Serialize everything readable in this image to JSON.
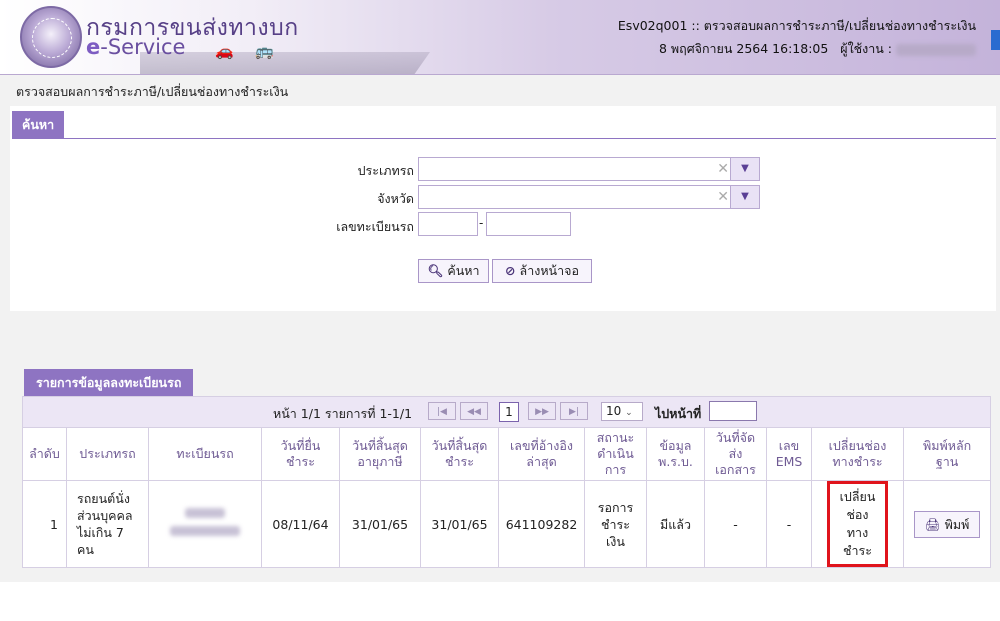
{
  "header": {
    "brand_title": "กรมการขนส่งทางบก",
    "brand_sub_prefix": "e",
    "brand_sub": "-Service",
    "screen_info": "Esv02q001 :: ตรวจสอบผลการชำระภาษี/เปลี่ยนช่องทางชำระเงิน",
    "datetime": "8 พฤศจิกายน 2564 16:18:05",
    "user_label": "ผู้ใช้งาน :"
  },
  "breadcrumb": "ตรวจสอบผลการชำระภาษี/เปลี่ยนช่องทางชำระเงิน",
  "search": {
    "tab_label": "ค้นหา",
    "vehicle_type_label": "ประเภทรถ",
    "province_label": "จังหวัด",
    "plate_label": "เลขทะเบียนรถ",
    "plate_separator": "-",
    "search_button": "ค้นหา",
    "clear_button": "ล้างหน้าจอ"
  },
  "results": {
    "tab_label": "รายการข้อมูลลงทะเบียนรถ",
    "pager": {
      "info": "หน้า 1/1 รายการที่ 1-1/1",
      "current_page": "1",
      "page_size": "10",
      "goto_label": "ไปหน้าที่"
    },
    "columns": {
      "c1": "ลำดับ",
      "c2": "ประเภทรถ",
      "c3": "ทะเบียนรถ",
      "c4a": "วันที่ยื่น",
      "c4b": "ชำระ",
      "c5a": "วันที่สิ้นสุด",
      "c5b": "อายุภาษี",
      "c6a": "วันที่สิ้นสุด",
      "c6b": "ชำระ",
      "c7a": "เลขที่อ้างอิง",
      "c7b": "ล่าสุด",
      "c8a": "สถานะ",
      "c8b": "ดำเนิน",
      "c8c": "การ",
      "c9a": "ข้อมูล",
      "c9b": "พ.ร.บ.",
      "c10a": "วันที่จัด",
      "c10b": "ส่ง",
      "c10c": "เอกสาร",
      "c11a": "เลข",
      "c11b": "EMS",
      "c12a": "เปลี่ยนช่อง",
      "c12b": "ทางชำระ",
      "c13a": "พิมพ์หลัก",
      "c13b": "ฐาน"
    },
    "row": {
      "seq": "1",
      "type_l1": "รถยนต์นั่ง",
      "type_l2": "ส่วนบุคคล",
      "type_l3": "ไม่เกิน 7",
      "type_l4": "คน",
      "submit_date": "08/11/64",
      "tax_end": "31/01/65",
      "pay_end": "31/01/65",
      "ref_no": "641109282",
      "status_l1": "รอการ",
      "status_l2": "ชำระ",
      "status_l3": "เงิน",
      "insurance": "มีแล้ว",
      "send_date": "-",
      "ems": "-",
      "change_l1": "เปลี่ยน",
      "change_l2": "ช่อง",
      "change_l3": "ทาง",
      "change_l4": "ชำระ",
      "print_label": "พิมพ์"
    }
  },
  "colors": {
    "accent": "#8e74c2",
    "highlight": "#e0141c"
  }
}
